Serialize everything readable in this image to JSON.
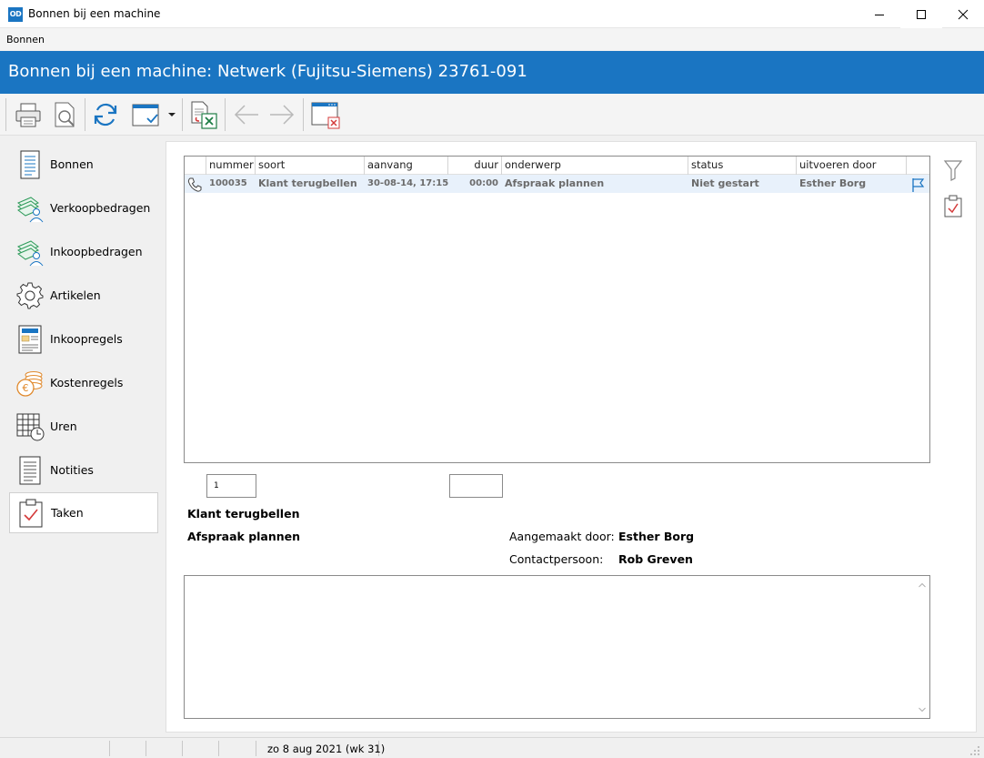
{
  "window": {
    "logo": "OD",
    "title": "Bonnen bij een machine"
  },
  "menu": {
    "items": [
      "Bonnen"
    ]
  },
  "banner": {
    "title": "Bonnen bij een machine: Netwerk (Fujitsu-Siemens)  23761-091"
  },
  "toolbar": {
    "buttons": [
      "printer-icon",
      "print-preview-icon",
      "refresh-icon",
      "view-layout-icon",
      "export-excel-icon",
      "back-arrow-icon",
      "forward-arrow-icon",
      "close-window-icon"
    ]
  },
  "sidebar": {
    "items": [
      {
        "label": "Bonnen",
        "icon": "document-icon"
      },
      {
        "label": "Verkoopbedragen",
        "icon": "money-person-icon"
      },
      {
        "label": "Inkoopbedragen",
        "icon": "money-person-icon"
      },
      {
        "label": "Artikelen",
        "icon": "gear-icon"
      },
      {
        "label": "Inkoopregels",
        "icon": "invoice-icon"
      },
      {
        "label": "Kostenregels",
        "icon": "coins-euro-icon"
      },
      {
        "label": "Uren",
        "icon": "timesheet-clock-icon"
      },
      {
        "label": "Notities",
        "icon": "notes-icon"
      },
      {
        "label": "Taken",
        "icon": "clipboard-check-icon",
        "active": true
      }
    ]
  },
  "grid": {
    "columns": [
      "",
      "nummer",
      "soort",
      "aanvang",
      "duur",
      "onderwerp",
      "status",
      "uitvoeren door",
      ""
    ],
    "rows": [
      {
        "type_icon": "phone-icon",
        "nummer": "100035",
        "soort": "Klant terugbellen",
        "aanvang": "30-08-14, 17:15",
        "duur": "00:00",
        "onderwerp": "Afspraak plannen",
        "status": "Niet gestart",
        "uitvoeren_door": "Esther Borg",
        "flag_icon": "flag-icon"
      }
    ]
  },
  "detail": {
    "number_box": "1",
    "second_box": "",
    "soort": "Klant terugbellen",
    "onderwerp": "Afspraak plannen",
    "created_by_label": "Aangemaakt door:",
    "created_by": "Esther Borg",
    "contact_label": "Contactpersoon:",
    "contact": "Rob Greven",
    "notes": ""
  },
  "right_tools": [
    "filter-icon",
    "clipboard-check-icon"
  ],
  "statusbar": {
    "date": "zo 8 aug 2021 (wk 31)"
  },
  "colors": {
    "accent": "#1a75c2",
    "row_highlight": "#e8f1fb",
    "excel_green": "#1e7d45",
    "close_red": "#d43a3a"
  }
}
